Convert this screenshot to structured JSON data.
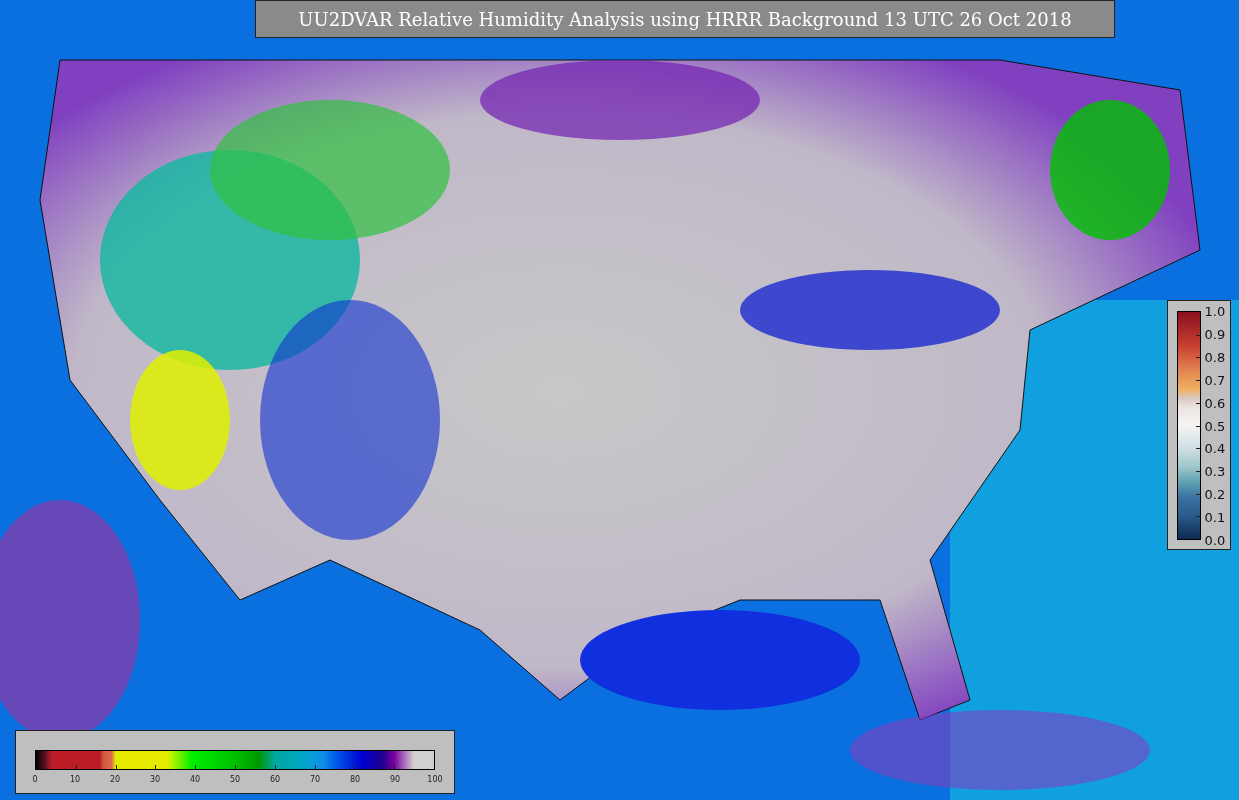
{
  "title": "UU2DVAR Relative Humidity Analysis using HRRR Background 13 UTC 26 Oct 2018",
  "humidity_colorbar": {
    "ticks": [
      "0",
      "10",
      "20",
      "30",
      "40",
      "50",
      "60",
      "70",
      "80",
      "90",
      "100"
    ]
  },
  "station_colorbar": {
    "ticks": [
      "1.0",
      "0.9",
      "0.8",
      "0.7",
      "0.6",
      "0.5",
      "0.4",
      "0.3",
      "0.2",
      "0.1",
      "0.0"
    ]
  }
}
